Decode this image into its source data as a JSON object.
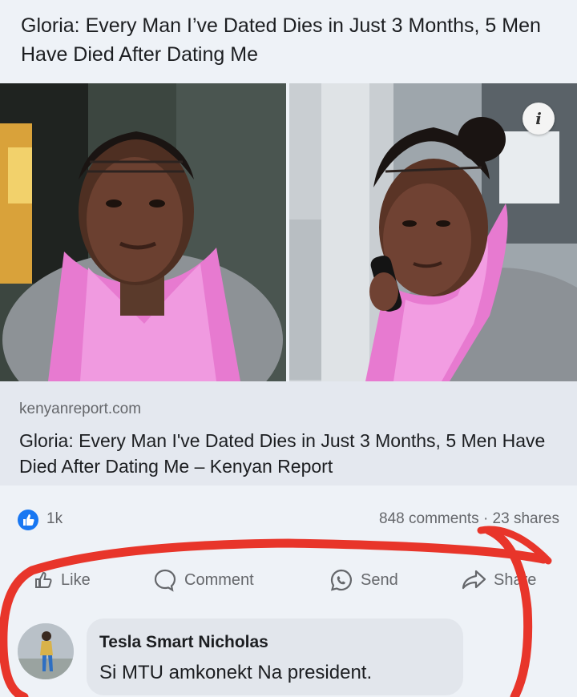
{
  "post": {
    "headline": "Gloria: Every Man I’ve Dated Dies in Just 3 Months, 5 Men Have Died After Dating Me",
    "info_icon_glyph": "i"
  },
  "link_preview": {
    "domain": "kenyanreport.com",
    "title": "Gloria: Every Man I've Dated Dies in Just 3 Months, 5 Men Have Died After Dating Me – Kenyan Report"
  },
  "stats": {
    "reactions_count": "1k",
    "comments": "848 comments",
    "separator": "·",
    "shares": "23 shares",
    "reaction_icon": "like-icon"
  },
  "actions": [
    {
      "label": "Like",
      "icon": "thumbs-up-icon"
    },
    {
      "label": "Comment",
      "icon": "comment-icon"
    },
    {
      "label": "Send",
      "icon": "messenger-icon"
    },
    {
      "label": "Share",
      "icon": "share-icon"
    }
  ],
  "comment": {
    "author": "Tesla Smart Nicholas",
    "text": "Si MTU amkonekt Na president."
  },
  "colors": {
    "accent": "#1877f2",
    "scarf": "#e77ad0",
    "annotation_red": "#e8352a",
    "muted_text": "#65676b"
  }
}
